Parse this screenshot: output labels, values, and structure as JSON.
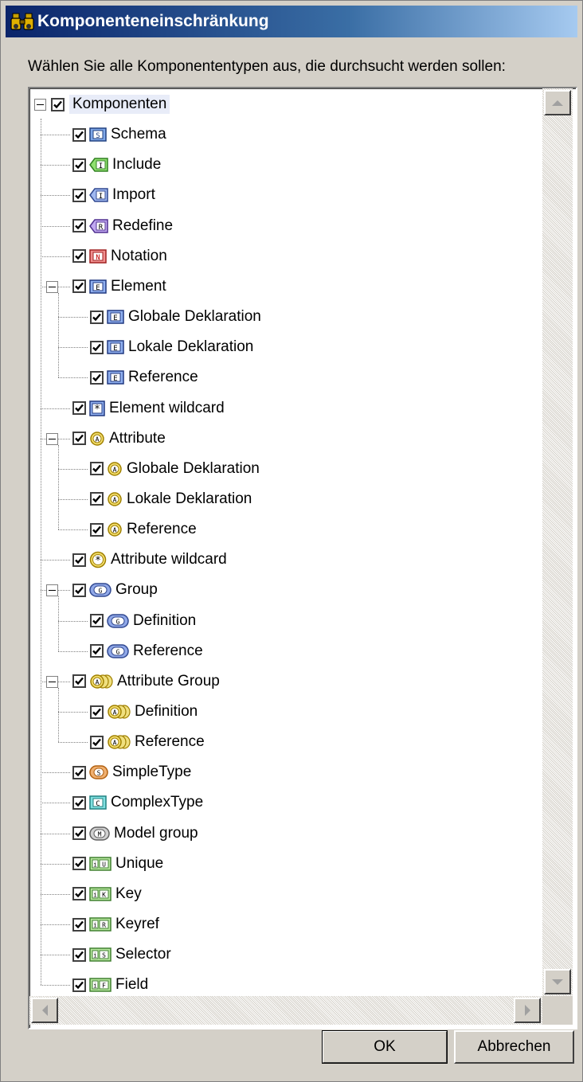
{
  "dialog": {
    "title": "Komponenteneinschränkung",
    "instruction": "Wählen Sie alle Komponententypen aus, die durchsucht werden sollen:",
    "ok_label": "OK",
    "cancel_label": "Abbrechen"
  },
  "tree": {
    "root": {
      "label": "Komponenten",
      "checked": true,
      "expanded": true
    },
    "items": [
      {
        "label": "Schema",
        "level": 1,
        "icon": "schema-icon",
        "checked": true
      },
      {
        "label": "Include",
        "level": 1,
        "icon": "include-icon",
        "checked": true
      },
      {
        "label": "Import",
        "level": 1,
        "icon": "import-icon",
        "checked": true
      },
      {
        "label": "Redefine",
        "level": 1,
        "icon": "redefine-icon",
        "checked": true
      },
      {
        "label": "Notation",
        "level": 1,
        "icon": "notation-icon",
        "checked": true
      },
      {
        "label": "Element",
        "level": 1,
        "icon": "element-icon",
        "checked": true,
        "expanded": true
      },
      {
        "label": "Globale Deklaration",
        "level": 2,
        "icon": "element-icon",
        "checked": true
      },
      {
        "label": "Lokale Deklaration",
        "level": 2,
        "icon": "element-icon",
        "checked": true
      },
      {
        "label": "Reference",
        "level": 2,
        "icon": "element-icon",
        "checked": true
      },
      {
        "label": "Element wildcard",
        "level": 1,
        "icon": "element-wildcard-icon",
        "checked": true
      },
      {
        "label": "Attribute",
        "level": 1,
        "icon": "attribute-icon",
        "checked": true,
        "expanded": true
      },
      {
        "label": "Globale Deklaration",
        "level": 2,
        "icon": "attribute-icon",
        "checked": true
      },
      {
        "label": "Lokale Deklaration",
        "level": 2,
        "icon": "attribute-icon",
        "checked": true
      },
      {
        "label": "Reference",
        "level": 2,
        "icon": "attribute-icon",
        "checked": true
      },
      {
        "label": "Attribute wildcard",
        "level": 1,
        "icon": "attribute-wildcard-icon",
        "checked": true
      },
      {
        "label": "Group",
        "level": 1,
        "icon": "group-icon",
        "checked": true,
        "expanded": true
      },
      {
        "label": "Definition",
        "level": 2,
        "icon": "group-icon",
        "checked": true
      },
      {
        "label": "Reference",
        "level": 2,
        "icon": "group-icon",
        "checked": true
      },
      {
        "label": "Attribute Group",
        "level": 1,
        "icon": "attribute-group-icon",
        "checked": true,
        "expanded": true
      },
      {
        "label": "Definition",
        "level": 2,
        "icon": "attribute-group-icon",
        "checked": true
      },
      {
        "label": "Reference",
        "level": 2,
        "icon": "attribute-group-icon",
        "checked": true
      },
      {
        "label": "SimpleType",
        "level": 1,
        "icon": "simpletype-icon",
        "checked": true
      },
      {
        "label": "ComplexType",
        "level": 1,
        "icon": "complextype-icon",
        "checked": true
      },
      {
        "label": "Model group",
        "level": 1,
        "icon": "model-group-icon",
        "checked": true
      },
      {
        "label": "Unique",
        "level": 1,
        "icon": "unique-icon",
        "checked": true
      },
      {
        "label": "Key",
        "level": 1,
        "icon": "key-icon",
        "checked": true
      },
      {
        "label": "Keyref",
        "level": 1,
        "icon": "keyref-icon",
        "checked": true
      },
      {
        "label": "Selector",
        "level": 1,
        "icon": "selector-icon",
        "checked": true
      },
      {
        "label": "Field",
        "level": 1,
        "icon": "field-icon",
        "checked": true
      }
    ]
  },
  "colors": {
    "title_start": "#0a246a",
    "title_end": "#a6caf0",
    "face": "#d4d0c8"
  }
}
